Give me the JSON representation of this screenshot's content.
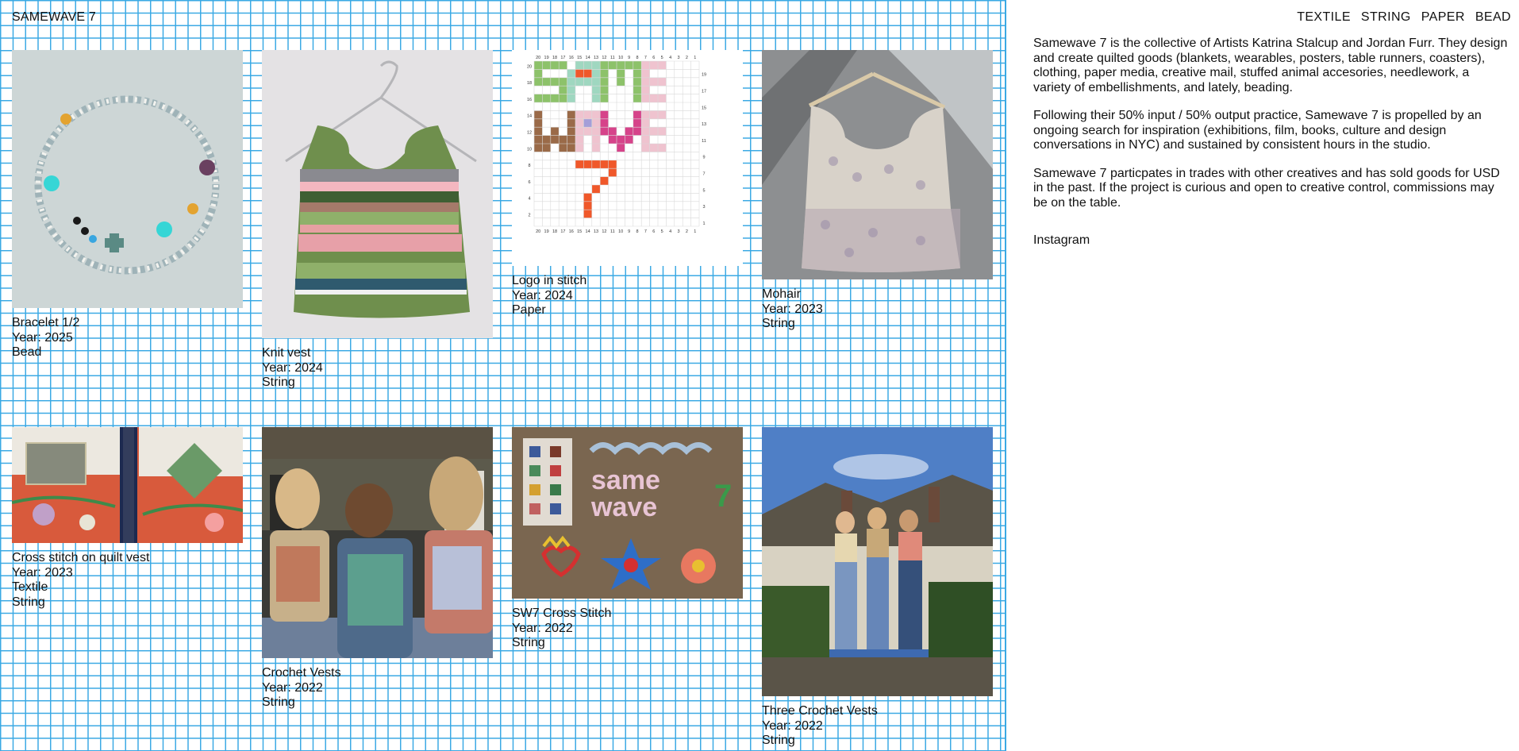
{
  "site": {
    "title": "SAMEWAVE 7"
  },
  "nav": [
    "TEXTILE",
    "STRING",
    "PAPER",
    "BEAD"
  ],
  "about": {
    "paragraphs": [
      "Samewave 7 is the collective of Artists Katrina Stalcup and Jordan Furr. They design and create quilted goods (blankets, wearables, posters, table runners, coasters), clothing, paper media, creative mail, stuffed animal accesories, needlework, a variety of embellishments, and lately, beading.",
      "Following their 50% input / 50% output practice, Samewave 7 is propelled by an ongoing search for inspiration (exhibitions, film, books, culture and design conversations in NYC) and sustained by consistent hours in the studio.",
      "Samewave 7 particpates in trades with other creatives and has sold goods for USD in the past. If the project is curious and open to creative control, commissions may be on the table."
    ],
    "instagram": "Instagram"
  },
  "items": [
    {
      "title": "Bracelet 1/2",
      "year": "Year: 2025",
      "tags": [
        "Bead"
      ]
    },
    {
      "title": "Knit vest",
      "year": "Year: 2024",
      "tags": [
        "String"
      ]
    },
    {
      "title": "Logo in stitch",
      "year": "Year: 2024",
      "tags": [
        "Paper"
      ]
    },
    {
      "title": "Mohair",
      "year": "Year: 2023",
      "tags": [
        "String"
      ]
    },
    {
      "title": "Cross stitch on quilt vest",
      "year": "Year: 2023",
      "tags": [
        "Textile",
        "String"
      ]
    },
    {
      "title": "Crochet Vests",
      "year": "Year: 2022",
      "tags": [
        "String"
      ]
    },
    {
      "title": "SW7 Cross Stitch",
      "year": "Year: 2022",
      "tags": [
        "String"
      ]
    },
    {
      "title": "Three Crochet Vests",
      "year": "Year: 2022",
      "tags": [
        "String"
      ]
    }
  ],
  "logo_chart": {
    "ruler_top": [
      "20",
      "19",
      "18",
      "17",
      "16",
      "15",
      "14",
      "13",
      "12",
      "11",
      "10",
      "9",
      "8",
      "7",
      "6",
      "5",
      "4",
      "3",
      "2",
      "1"
    ],
    "ruler_left": [
      "20",
      "18",
      "16",
      "14",
      "12",
      "10",
      "8",
      "6",
      "4",
      "2"
    ],
    "ruler_right": [
      "19",
      "17",
      "15",
      "13",
      "11",
      "9",
      "7",
      "5",
      "3",
      "1"
    ]
  },
  "colors": {
    "grid_line": "#3aa9e4",
    "text": "#111111",
    "logo_green": "#8dc26a",
    "logo_mint": "#9fd7c0",
    "logo_pink": "#efc3cf",
    "logo_brown": "#9a6a48",
    "logo_magenta": "#d6438a",
    "logo_orange": "#f0582a",
    "logo_lavender": "#a59ed8"
  }
}
